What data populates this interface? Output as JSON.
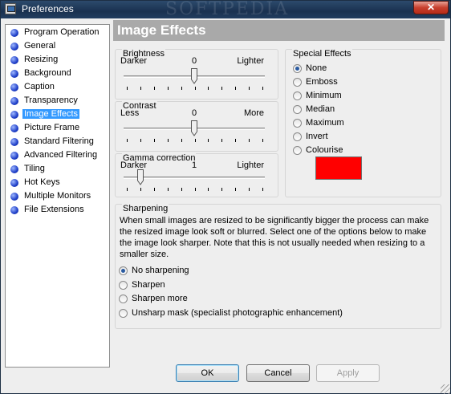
{
  "window": {
    "title": "Preferences",
    "watermark": "SOFTPEDIA",
    "close_glyph": "✕"
  },
  "nav": {
    "items": [
      {
        "label": "Program Operation"
      },
      {
        "label": "General"
      },
      {
        "label": "Resizing"
      },
      {
        "label": "Background"
      },
      {
        "label": "Caption"
      },
      {
        "label": "Transparency"
      },
      {
        "label": "Image Effects",
        "selected": true
      },
      {
        "label": "Picture Frame"
      },
      {
        "label": "Standard Filtering"
      },
      {
        "label": "Advanced Filtering"
      },
      {
        "label": "Tiling"
      },
      {
        "label": "Hot Keys"
      },
      {
        "label": "Multiple Monitors"
      },
      {
        "label": "File Extensions"
      }
    ]
  },
  "header": {
    "title": "Image Effects"
  },
  "brightness": {
    "title": "Brightness",
    "left_label": "Darker",
    "value": "0",
    "right_label": "Lighter",
    "level": 0.5
  },
  "contrast": {
    "title": "Contrast",
    "left_label": "Less",
    "value": "0",
    "right_label": "More",
    "level": 0.5
  },
  "gamma": {
    "title": "Gamma correction",
    "left_label": "Darker",
    "value": "1",
    "right_label": "Lighter",
    "level": 0.1
  },
  "special_effects": {
    "title": "Special Effects",
    "options": [
      {
        "label": "None",
        "checked": true
      },
      {
        "label": "Emboss",
        "checked": false
      },
      {
        "label": "Minimum",
        "checked": false
      },
      {
        "label": "Median",
        "checked": false
      },
      {
        "label": "Maximum",
        "checked": false
      },
      {
        "label": "Invert",
        "checked": false
      },
      {
        "label": "Colourise",
        "checked": false
      }
    ],
    "colour": "#ff0000"
  },
  "sharpening": {
    "title": "Sharpening",
    "description": "When small images are resized to be significantly bigger the process can make the resized image look soft or blurred. Select one of the options below to make the image look sharper. Note that this is not usually needed when resizing to a smaller size.",
    "options": [
      {
        "label": "No sharpening",
        "checked": true
      },
      {
        "label": "Sharpen",
        "checked": false
      },
      {
        "label": "Sharpen more",
        "checked": false
      },
      {
        "label": "Unsharp mask (specialist photographic enhancement)",
        "checked": false
      }
    ]
  },
  "buttons": {
    "ok": "OK",
    "cancel": "Cancel",
    "apply": "Apply"
  }
}
